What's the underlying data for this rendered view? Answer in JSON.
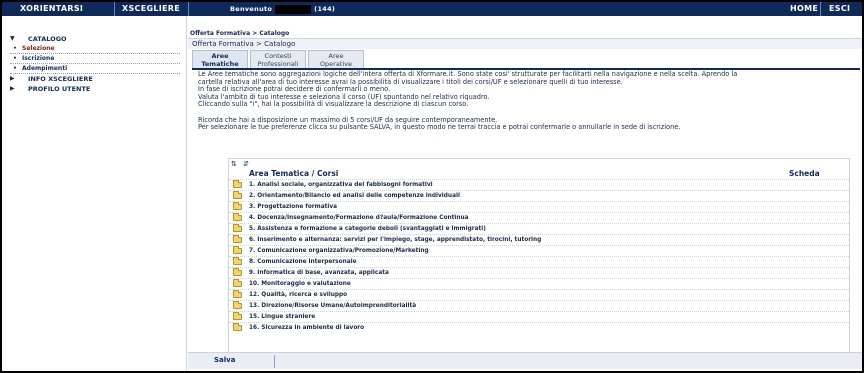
{
  "topbar": {
    "xorientarsi": "XORIENTARSI",
    "xscegliere": "XSCEGLIERE",
    "welcome": "Benvenuto",
    "welcome_count": "(144)",
    "home": "HOME",
    "esci": "ESCI"
  },
  "sidebar": {
    "catalogo": "CATALOGO",
    "sub": [
      "Selezione",
      "Iscrizione",
      "Adempimenti"
    ],
    "info": "INFO XSCEGLIERE",
    "profilo": "PROFILO UTENTE"
  },
  "main": {
    "breadcrumb_small": "Offerta Formativa > Catalogo",
    "breadcrumb": "Offerta Formativa > Catalogo",
    "tabs": [
      {
        "line1": "Aree",
        "line2": "Tematiche"
      },
      {
        "line1": "Contesti",
        "line2": "Professionali"
      },
      {
        "line1": "Aree",
        "line2": "Operative"
      }
    ],
    "intro": [
      "Le Aree tematiche sono aggregazioni logiche dell'intera offerta di Xformare.it. Sono state cosi' strutturate per facilitarti nella navigazione e nella scelta. Aprendo la",
      "cartella relativa all'area di tuo interesse avrai la possibilità di visualizzare i titoli dei corsi/UF e selezionare quelli di tuo interesse.",
      "In fase di iscrizione potrai decidere di confermarli o meno.",
      "Valuta l'ambito di tuo interesse e seleziona il corso (UF) spuntando nel relativo riquadro.",
      "Cliccando sulla \"i\", hai la possibilità di visualizzare la descrizione di ciascun corso.",
      "",
      "Ricorda che hai a disposizione un massimo di 5 corsi/UF da seguire contemporaneamente.",
      "Per selezionare le tue preferenze clicca su pulsante SALVA, in questo modo ne terrai traccia e potrai confermarle o annullarle in sede di iscrizione."
    ],
    "col_area": "Area Tematica / Corsi",
    "col_scheda": "Scheda",
    "areas": [
      "1. Analisi sociale, organizzativa dei fabbisogni formativi",
      "2. Orientamento/Bilancio ed analisi delle competenze individuali",
      "3. Progettazione formativa",
      "4. Docenza/Insegnamento/Formazione d?aula/Formazione Continua",
      "5. Assistenza e formazione a categorie deboli (svantaggiati e immigrati)",
      "6. Inserimento e alternanza: servizi per l'impiego, stage, apprendistato, tirocini, tutoring",
      "7. Comunicazione organizzativa/Promozione/Marketing",
      "8. Comunicazione interpersonale",
      "9. Informatica di base, avanzata, applicata",
      "10. Monitoraggio e valutazione",
      "12. Qualità, ricerca e sviluppo",
      "13. Direzione/Risorse Umane/Autoimprenditorialità",
      "15. Lingue straniere",
      "16. Sicurezza in ambiente di lavoro"
    ],
    "save_label": "Salva"
  },
  "colors": {
    "navy": "#0e2a5c",
    "folder": "#f2d46a"
  }
}
